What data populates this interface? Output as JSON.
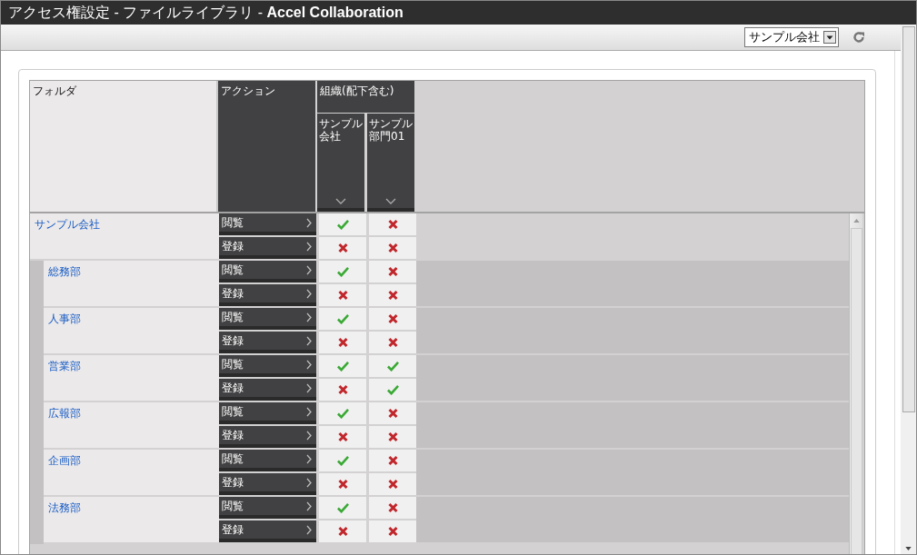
{
  "window": {
    "title": "アクセス権設定 - ファイルライブラリ - **Accel Collaboration**"
  },
  "toolbar": {
    "company_select": {
      "value": "サンプル会社"
    }
  },
  "table": {
    "columns": {
      "folder": "フォルダ",
      "action": "アクション",
      "group": "組織(配下含む)",
      "orgs": [
        "サンプル会社",
        "サンプル部門01"
      ]
    },
    "folders": [
      {
        "name": "サンプル会社",
        "actions": [
          {
            "label": "閲覧",
            "allowed": [
              true,
              false
            ]
          },
          {
            "label": "登録",
            "allowed": [
              false,
              false
            ]
          }
        ],
        "children": [
          {
            "name": "総務部",
            "actions": [
              {
                "label": "閲覧",
                "allowed": [
                  true,
                  false
                ]
              },
              {
                "label": "登録",
                "allowed": [
                  false,
                  false
                ]
              }
            ]
          },
          {
            "name": "人事部",
            "actions": [
              {
                "label": "閲覧",
                "allowed": [
                  true,
                  false
                ]
              },
              {
                "label": "登録",
                "allowed": [
                  false,
                  false
                ]
              }
            ]
          },
          {
            "name": "営業部",
            "actions": [
              {
                "label": "閲覧",
                "allowed": [
                  true,
                  true
                ]
              },
              {
                "label": "登録",
                "allowed": [
                  false,
                  true
                ]
              }
            ]
          },
          {
            "name": "広報部",
            "actions": [
              {
                "label": "閲覧",
                "allowed": [
                  true,
                  false
                ]
              },
              {
                "label": "登録",
                "allowed": [
                  false,
                  false
                ]
              }
            ]
          },
          {
            "name": "企画部",
            "actions": [
              {
                "label": "閲覧",
                "allowed": [
                  true,
                  false
                ]
              },
              {
                "label": "登録",
                "allowed": [
                  false,
                  false
                ]
              }
            ]
          },
          {
            "name": "法務部",
            "actions": [
              {
                "label": "閲覧",
                "allowed": [
                  true,
                  false
                ]
              },
              {
                "label": "登録",
                "allowed": [
                  false,
                  false
                ]
              }
            ]
          }
        ]
      }
    ]
  }
}
